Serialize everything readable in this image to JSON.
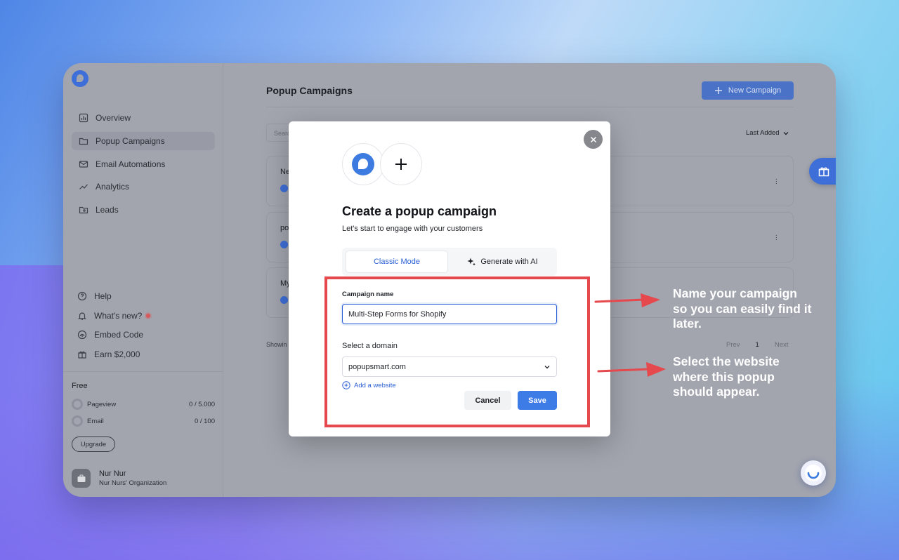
{
  "sidebar": {
    "nav": [
      "Overview",
      "Popup Campaigns",
      "Email Automations",
      "Analytics",
      "Leads"
    ],
    "bottom": [
      "Help",
      "What's new?",
      "Embed Code",
      "Earn $2,000"
    ],
    "plan": {
      "title": "Free",
      "quotas": [
        {
          "label": "Pageview",
          "value": "0 / 5.000"
        },
        {
          "label": "Email",
          "value": "0 / 100"
        }
      ],
      "upgrade_label": "Upgrade"
    },
    "user": {
      "name": "Nur Nur",
      "org": "Nur Nurs' Organization"
    }
  },
  "main": {
    "title": "Popup Campaigns",
    "new_campaign_label": "New Campaign",
    "search_placeholder": "Searc",
    "sort_label": "Last Added",
    "campaigns": [
      "Ne",
      "po",
      "My"
    ],
    "showing_text": "Showin",
    "pager": {
      "prev": "Prev",
      "current": "1",
      "next": "Next"
    }
  },
  "modal": {
    "title": "Create a popup campaign",
    "subtitle": "Let's start to engage with your customers",
    "tabs": {
      "classic": "Classic Mode",
      "ai": "Generate with AI"
    },
    "campaign_name_label": "Campaign name",
    "campaign_name_value": "Multi-Step Forms for Shopify",
    "domain_label": "Select a domain",
    "domain_value": "popupsmart.com",
    "add_website_label": "Add a website",
    "cancel_label": "Cancel",
    "save_label": "Save"
  },
  "annotations": {
    "name_hint": "Name your campaign so you can easily find it later.",
    "domain_hint": "Select the website where this popup should appear."
  },
  "colors": {
    "accent": "#3d7be6",
    "highlight": "#e5484d",
    "overlay": "#a2a5ae"
  }
}
